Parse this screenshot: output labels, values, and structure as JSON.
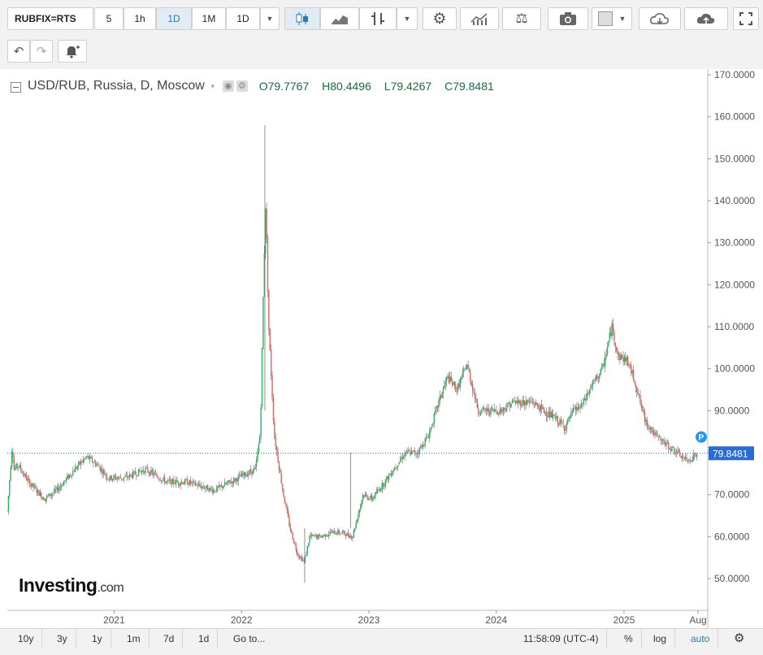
{
  "toolbar": {
    "symbol": "RUBFIX=RTS",
    "intervals": [
      "5",
      "1h",
      "1D",
      "1M",
      "1D"
    ],
    "active_interval": "1D"
  },
  "chart_data": {
    "type": "candlestick",
    "title": "USD/RUB, Russia, D, Moscow",
    "ohlc": {
      "o_label": "O",
      "o": "79.7767",
      "h_label": "H",
      "h": "80.4496",
      "l_label": "L",
      "l": "79.4267",
      "c_label": "C",
      "c": "79.8481"
    },
    "y_ticks": [
      "170.0000",
      "160.0000",
      "150.0000",
      "140.0000",
      "130.0000",
      "120.0000",
      "110.0000",
      "100.0000",
      "90.0000",
      "80.0000",
      "70.0000",
      "60.0000",
      "50.0000"
    ],
    "ylim": [
      44,
      170
    ],
    "x_ticks": [
      "2021",
      "2022",
      "2023",
      "2024",
      "2025",
      "Aug"
    ],
    "xlim": [
      "2020-03-01",
      "2025-08-01"
    ],
    "last_price": "79.8481",
    "last_price_value": 79.8481,
    "price_marker": "P",
    "series": [
      {
        "x": [
          "2020-03-01",
          "2020-03-15",
          "2020-03-20",
          "2020-04-01",
          "2020-05-01",
          "2020-06-15",
          "2020-07-20",
          "2020-08-20",
          "2020-09-20",
          "2020-10-15",
          "2020-11-15",
          "2020-12-15",
          "2021-02-01",
          "2021-04-01",
          "2021-06-01",
          "2021-08-01",
          "2021-10-15",
          "2021-11-30",
          "2022-01-15",
          "2022-02-10",
          "2022-02-24",
          "2022-03-05",
          "2022-03-11",
          "2022-03-20",
          "2022-04-05",
          "2022-05-01",
          "2022-05-20",
          "2022-06-10",
          "2022-06-30",
          "2022-07-15",
          "2022-08-15",
          "2022-09-15",
          "2022-10-15",
          "2022-11-15",
          "2022-12-15",
          "2023-01-10",
          "2023-02-15",
          "2023-03-20",
          "2023-04-15",
          "2023-05-20",
          "2023-06-20",
          "2023-07-20",
          "2023-08-14",
          "2023-09-10",
          "2023-10-09",
          "2023-11-10",
          "2023-12-15",
          "2024-01-15",
          "2024-02-15",
          "2024-03-15",
          "2024-04-15",
          "2024-05-15",
          "2024-06-20",
          "2024-07-15",
          "2024-08-10",
          "2024-09-01",
          "2024-10-01",
          "2024-11-01",
          "2024-11-27",
          "2024-12-15",
          "2025-01-10",
          "2025-02-01",
          "2025-03-01",
          "2025-04-01",
          "2025-05-01",
          "2025-06-01",
          "2025-07-01",
          "2025-08-01"
        ],
        "y": [
          66,
          82,
          76,
          77,
          73,
          69,
          71,
          74,
          77,
          79,
          77,
          74,
          74,
          76,
          73,
          73,
          71,
          73,
          75,
          76,
          85,
          120,
          140,
          110,
          84,
          70,
          62,
          56,
          54,
          60,
          60,
          61,
          61,
          60,
          70,
          69,
          73,
          77,
          80,
          80,
          84,
          92,
          98,
          95,
          101,
          90,
          90,
          90,
          92,
          92,
          92,
          90,
          88,
          86,
          90,
          91,
          96,
          100,
          110,
          103,
          102,
          97,
          88,
          84,
          82,
          80,
          78,
          79.85
        ]
      }
    ]
  },
  "watermark": {
    "brand": "Investing",
    "suffix": ".com"
  },
  "bottom_bar": {
    "ranges": [
      "10y",
      "3y",
      "1y",
      "1m",
      "7d",
      "1d",
      "Go to..."
    ],
    "time": "11:58:09 (UTC-4)",
    "percent": "%",
    "log": "log",
    "auto": "auto"
  }
}
